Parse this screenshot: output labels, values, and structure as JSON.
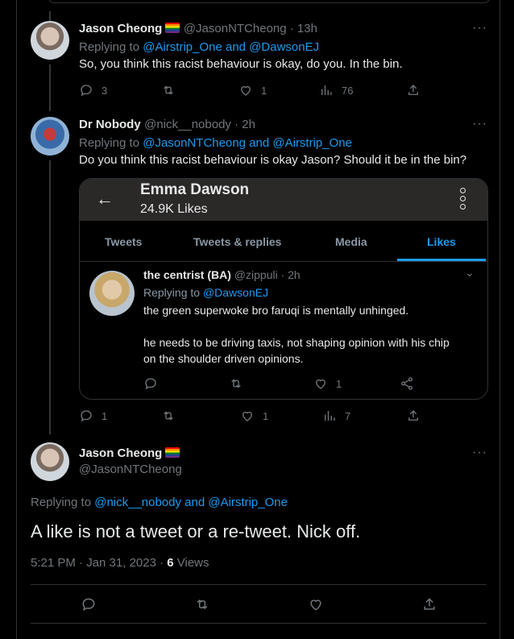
{
  "tweets": [
    {
      "name": "Jason Cheong",
      "handle": "@JasonNTCheong · 13h",
      "replying_prefix": "Replying to ",
      "replying_links": "@Airstrip_One and @DawsonEJ",
      "text": "So, you think this racist behaviour is okay, do you. In the bin.",
      "replies": "3",
      "likes": "1",
      "views": "76"
    },
    {
      "name": "Dr Nobody",
      "handle": "@nick__nobody · 2h",
      "replying_prefix": "Replying to ",
      "replying_links": "@JasonNTCheong and @Airstrip_One",
      "text": "Do you think this racist behaviour is okay Jason? Should it be in the bin?",
      "replies": "1",
      "likes": "1",
      "views": "7"
    }
  ],
  "embed": {
    "profile_name": "Emma Dawson",
    "profile_likes": "24.9K Likes",
    "tabs": [
      "Tweets",
      "Tweets & replies",
      "Media",
      "Likes"
    ],
    "active_tab": "Likes",
    "inner_name": "the centrist (BA)",
    "inner_handle": "@zippuli · 2h",
    "inner_reply_prefix": "Replying to ",
    "inner_reply_link": "@DawsonEJ",
    "inner_text_1": "the green superwoke bro faruqi is mentally unhinged.",
    "inner_text_2": "he needs to be driving taxis, not shaping opinion with his chip",
    "inner_text_3": "on the shoulder driven opinions.",
    "inner_likes": "1"
  },
  "main": {
    "name": "Jason Cheong",
    "handle": "@JasonNTCheong",
    "replying_prefix": "Replying to ",
    "replying_links": "@nick__nobody and @Airstrip_One",
    "text": "A like is not a tweet or a re-tweet. Nick off.",
    "time": "5:21 PM · Jan 31, 2023 · ",
    "views_count": "6",
    "views_label": " Views"
  },
  "colors": {
    "accent": "#1d9bf0",
    "muted": "#71767b",
    "text": "#e7e9ea",
    "bg": "#000000"
  }
}
